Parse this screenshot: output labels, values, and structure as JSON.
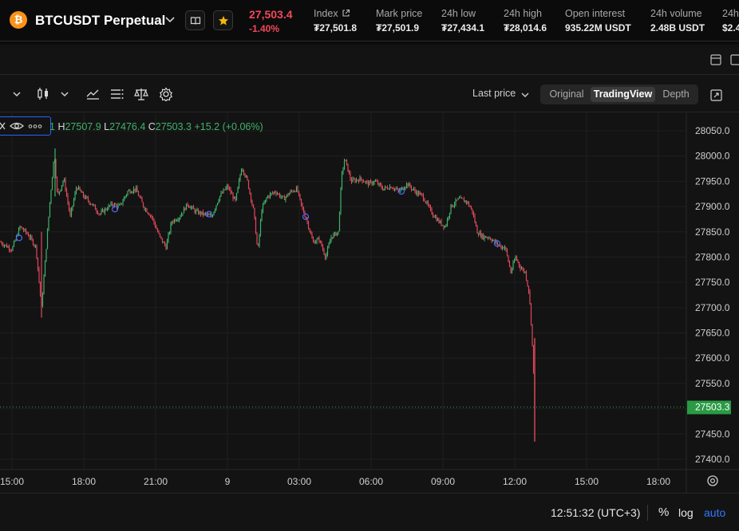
{
  "header": {
    "coin_glyph": "₿",
    "symbol": "BTCUSDT Perpetual",
    "last_price": "27,503.4",
    "change_pct": "-1.40%",
    "stats": [
      {
        "label": "Index",
        "value": "₮27,501.8",
        "icon": "external-link-icon"
      },
      {
        "label": "Mark price",
        "value": "₮27,501.9"
      },
      {
        "label": "24h low",
        "value": "₮27,434.1"
      },
      {
        "label": "24h high",
        "value": "₮28,014.6"
      },
      {
        "label": "Open interest",
        "value": "935.22M USDT"
      },
      {
        "label": "24h volume",
        "value": "2.48B USDT"
      },
      {
        "label": "24h",
        "value": "$2.4"
      }
    ]
  },
  "toolbar": {
    "price_source": "Last price",
    "views": [
      "Original",
      "TradingView",
      "Depth"
    ],
    "active_view": "TradingView"
  },
  "legend": {
    "interval": "1",
    "high_label": "H",
    "high": "27507.9",
    "low_label": "L",
    "low": "27476.4",
    "close_label": "C",
    "close": "27503.3",
    "change": "+15.2 (+0.06%)"
  },
  "footer": {
    "clock": "12:51:32 (UTC+3)",
    "percent": "%",
    "log": "log",
    "auto": "auto"
  },
  "colors": {
    "up": "#3fb36b",
    "down": "#e0475b",
    "price_line": "#2a9a45",
    "last_price": "#f2485a",
    "accent": "#2f7bff"
  },
  "chart_data": {
    "type": "candlestick",
    "x_ticks": [
      "15:00",
      "18:00",
      "21:00",
      "9",
      "03:00",
      "06:00",
      "09:00",
      "12:00",
      "15:00",
      "18:00"
    ],
    "y_ticks": [
      28050.0,
      28000.0,
      27950.0,
      27900.0,
      27850.0,
      27800.0,
      27750.0,
      27700.0,
      27650.0,
      27600.0,
      27550.0,
      27500.0,
      27450.0,
      27400.0
    ],
    "ylim": [
      27375,
      28085
    ],
    "last_price_label": "27503.3",
    "last_price": 27503.3,
    "price_path": [
      [
        0,
        27830
      ],
      [
        15,
        27815
      ],
      [
        25,
        27860
      ],
      [
        35,
        27845
      ],
      [
        45,
        27820
      ],
      [
        52,
        27700
      ],
      [
        55,
        27760
      ],
      [
        62,
        27900
      ],
      [
        68,
        28005
      ],
      [
        72,
        27920
      ],
      [
        80,
        27955
      ],
      [
        88,
        27880
      ],
      [
        96,
        27940
      ],
      [
        105,
        27920
      ],
      [
        115,
        27905
      ],
      [
        125,
        27885
      ],
      [
        140,
        27905
      ],
      [
        150,
        27900
      ],
      [
        160,
        27930
      ],
      [
        170,
        27935
      ],
      [
        180,
        27900
      ],
      [
        190,
        27880
      ],
      [
        200,
        27840
      ],
      [
        208,
        27820
      ],
      [
        215,
        27870
      ],
      [
        225,
        27880
      ],
      [
        235,
        27905
      ],
      [
        245,
        27890
      ],
      [
        255,
        27885
      ],
      [
        265,
        27880
      ],
      [
        275,
        27920
      ],
      [
        285,
        27940
      ],
      [
        295,
        27910
      ],
      [
        303,
        27980
      ],
      [
        310,
        27950
      ],
      [
        318,
        27890
      ],
      [
        323,
        27810
      ],
      [
        328,
        27895
      ],
      [
        335,
        27920
      ],
      [
        345,
        27930
      ],
      [
        355,
        27915
      ],
      [
        365,
        27930
      ],
      [
        372,
        27935
      ],
      [
        378,
        27900
      ],
      [
        385,
        27870
      ],
      [
        392,
        27830
      ],
      [
        400,
        27835
      ],
      [
        408,
        27800
      ],
      [
        415,
        27840
      ],
      [
        424,
        27850
      ],
      [
        428,
        27960
      ],
      [
        432,
        27995
      ],
      [
        440,
        27950
      ],
      [
        452,
        27955
      ],
      [
        462,
        27945
      ],
      [
        470,
        27950
      ],
      [
        480,
        27935
      ],
      [
        490,
        27940
      ],
      [
        500,
        27930
      ],
      [
        510,
        27945
      ],
      [
        520,
        27930
      ],
      [
        530,
        27920
      ],
      [
        540,
        27890
      ],
      [
        550,
        27870
      ],
      [
        558,
        27860
      ],
      [
        565,
        27900
      ],
      [
        575,
        27915
      ],
      [
        585,
        27910
      ],
      [
        592,
        27890
      ],
      [
        598,
        27850
      ],
      [
        605,
        27840
      ],
      [
        612,
        27840
      ],
      [
        620,
        27830
      ],
      [
        627,
        27820
      ],
      [
        633,
        27820
      ],
      [
        640,
        27770
      ],
      [
        646,
        27800
      ],
      [
        652,
        27780
      ],
      [
        658,
        27770
      ],
      [
        663,
        27730
      ],
      [
        666,
        27660
      ],
      [
        668,
        27590
      ],
      [
        670,
        27510
      ],
      [
        671,
        27503
      ]
    ],
    "markers": [
      {
        "x": 24,
        "y": 27838
      },
      {
        "x": 144,
        "y": 27895
      },
      {
        "x": 262,
        "y": 27885
      },
      {
        "x": 383,
        "y": 27880
      },
      {
        "x": 503,
        "y": 27930
      },
      {
        "x": 623,
        "y": 27827
      }
    ]
  }
}
